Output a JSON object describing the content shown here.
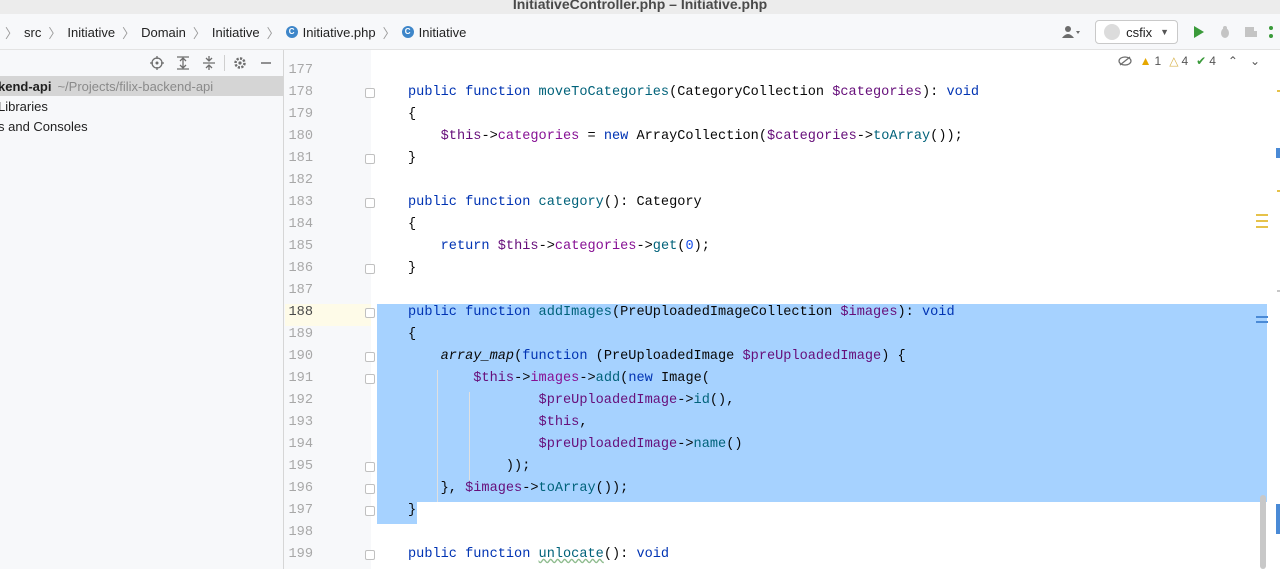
{
  "window": {
    "title": "InitiativeController.php – Initiative.php"
  },
  "breadcrumb": [
    {
      "label": "src",
      "icon": ""
    },
    {
      "label": "Initiative",
      "icon": ""
    },
    {
      "label": "Domain",
      "icon": ""
    },
    {
      "label": "Initiative",
      "icon": ""
    },
    {
      "label": "Initiative.php",
      "icon": "class-icon"
    },
    {
      "label": "Initiative",
      "icon": "class-icon"
    }
  ],
  "run_config": {
    "label": "csfix"
  },
  "project": {
    "root_name": "kend-api",
    "root_path": "~/Projects/filix-backend-api",
    "items": [
      "Libraries",
      "s and Consoles"
    ]
  },
  "inspections": {
    "warnings": "1",
    "weak_warnings": "4",
    "ok": "4"
  },
  "editor": {
    "line_numbers": [
      "177",
      "178",
      "179",
      "180",
      "181",
      "182",
      "183",
      "184",
      "185",
      "186",
      "187",
      "188",
      "189",
      "190",
      "191",
      "192",
      "193",
      "194",
      "195",
      "196",
      "197",
      "198",
      "199"
    ],
    "current_line": "188"
  },
  "colors": {
    "selection": "#a6d2ff",
    "keyword": "#0033b3",
    "function": "#00627a",
    "field": "#871094",
    "variable": "#660e7a"
  }
}
